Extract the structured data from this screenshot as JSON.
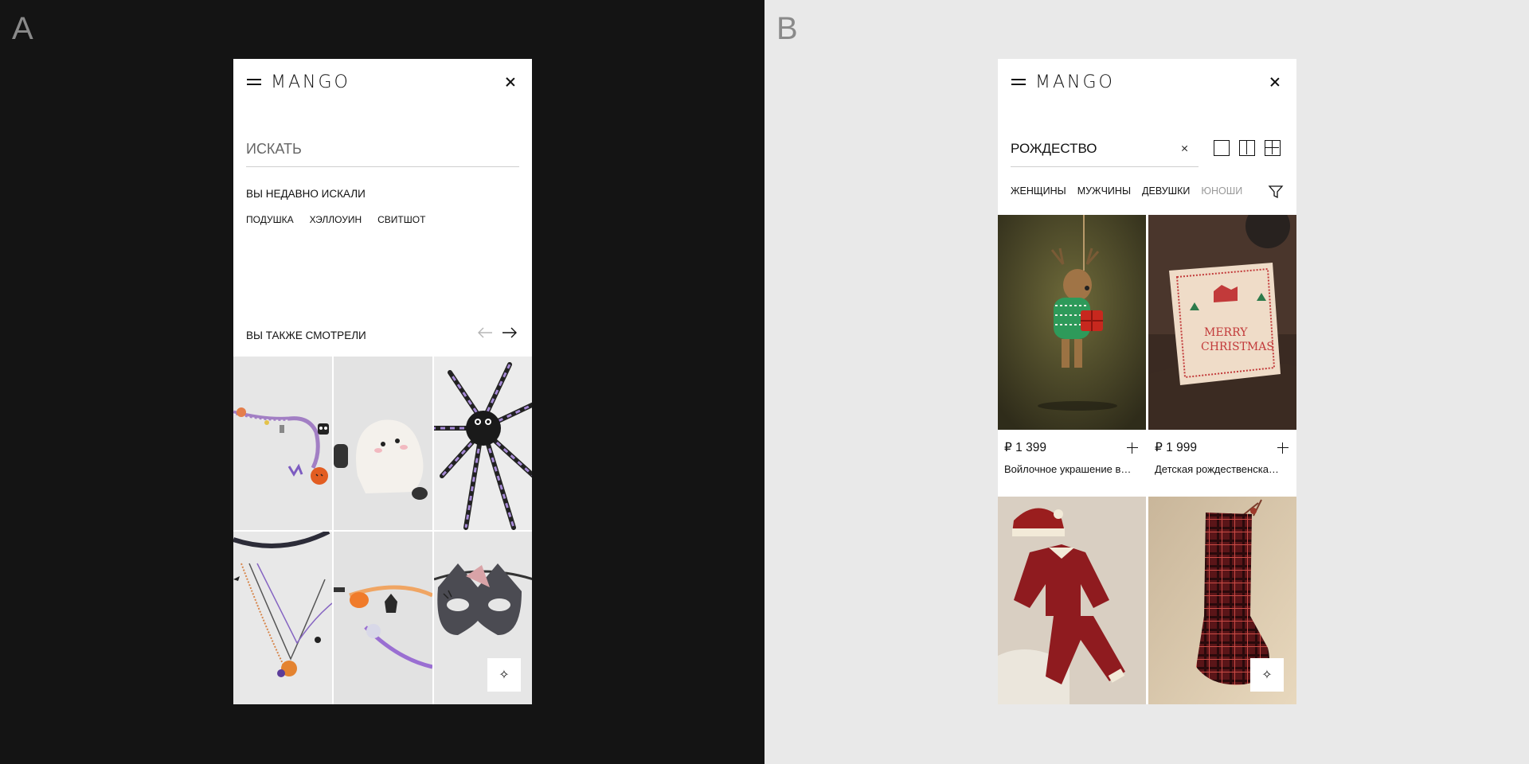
{
  "panels": {
    "a_letter": "A",
    "b_letter": "B"
  },
  "brand": {
    "logo": "MANGO"
  },
  "panel_a": {
    "search": {
      "placeholder": "ИСКАТЬ",
      "value": ""
    },
    "recent": {
      "title": "ВЫ НЕДАВНО ИСКАЛИ",
      "items": [
        "ПОДУШКА",
        "ХЭЛЛОУИН",
        "СВИТШОТ"
      ]
    },
    "also_seen": {
      "title": "ВЫ ТАКЖЕ СМОТРЕЛИ"
    }
  },
  "panel_b": {
    "search": {
      "value": "РОЖДЕСТВО"
    },
    "categories": [
      "ЖЕНЩИНЫ",
      "МУЖЧИНЫ",
      "ДЕВУШКИ",
      "ЮНОШИ"
    ],
    "products": [
      {
        "price": "₽ 1 399",
        "name": "Войлочное украшение в…"
      },
      {
        "price": "₽ 1 999",
        "name": "Детская рождественска…"
      }
    ]
  },
  "icons": {
    "ai_assistant": "sparkle-icon",
    "ai_symbol": "✧"
  }
}
